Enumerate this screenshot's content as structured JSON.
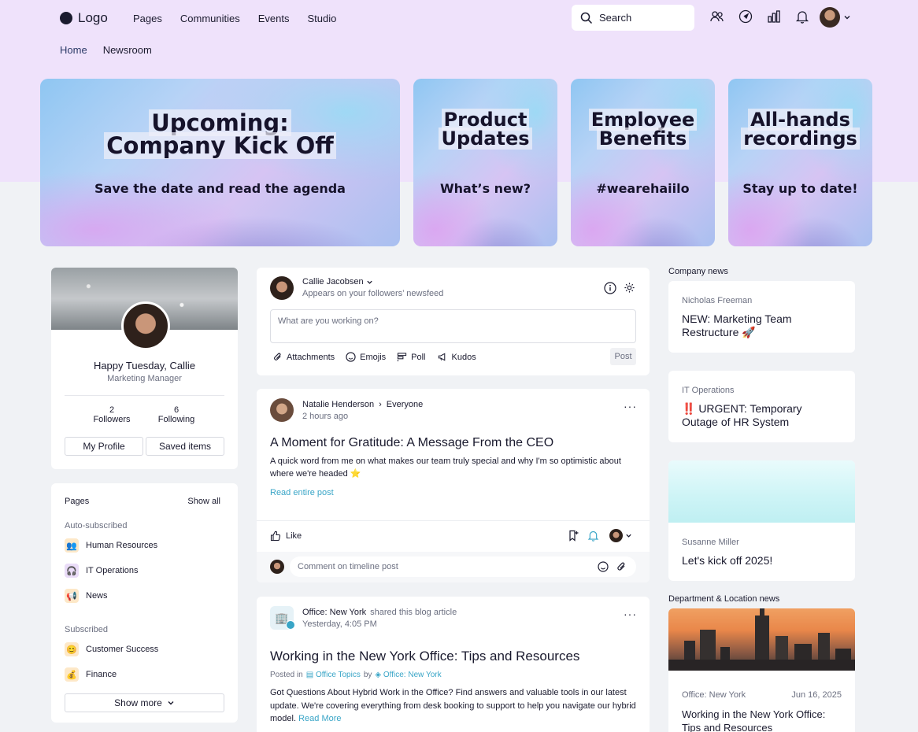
{
  "nav": {
    "logo": "Logo",
    "links": [
      "Pages",
      "Communities",
      "Events",
      "Studio"
    ],
    "search_placeholder": "Search",
    "subnav": [
      "Home",
      "Newsroom"
    ]
  },
  "banners": [
    {
      "title_line1": "Upcoming:",
      "title_line2": "Company Kick Off",
      "subtitle": "Save the date and read the agenda"
    },
    {
      "title_line1": "Product",
      "title_line2": "Updates",
      "subtitle": "What’s new?"
    },
    {
      "title_line1": "Employee",
      "title_line2": "Benefits",
      "subtitle": "#wearehaiilo"
    },
    {
      "title_line1": "All-hands",
      "title_line2": "recordings",
      "subtitle": "Stay up to date!"
    }
  ],
  "profile": {
    "greeting": "Happy Tuesday, Callie",
    "role": "Marketing Manager",
    "followers_count": "2",
    "followers_label": "Followers",
    "following_count": "6",
    "following_label": "Following",
    "my_profile": "My Profile",
    "saved_items": "Saved items"
  },
  "pages": {
    "title": "Pages",
    "show_all": "Show all",
    "auto_label": "Auto-subscribed",
    "auto_items": [
      "Human Resources",
      "IT Operations",
      "News"
    ],
    "sub_label": "Subscribed",
    "sub_items": [
      "Customer Success",
      "Finance"
    ],
    "show_more": "Show more"
  },
  "composer": {
    "author": "Callie Jacobsen",
    "audience": "Appears on your followers’ newsfeed",
    "placeholder": "What are you working on?",
    "attachments": "Attachments",
    "emojis": "Emojis",
    "poll": "Poll",
    "kudos": "Kudos",
    "post": "Post"
  },
  "post1": {
    "author": "Natalie Henderson",
    "target": "Everyone",
    "time": "2 hours ago",
    "title": "A Moment for Gratitude: A Message From the CEO",
    "body_line1": "A quick word from me on what makes our team truly special and why I'm so optimistic about",
    "body_line2": "where we're headed ⭐",
    "read_more": "Read entire post",
    "like": "Like",
    "comment_placeholder": "Comment on timeline post"
  },
  "post2": {
    "author": "Office: New York",
    "action": "shared this blog article",
    "time": "Yesterday, 4:05 PM",
    "title": "Working in the New York Office: Tips and Resources",
    "posted_in": "Posted in",
    "topic": "Office Topics",
    "by": "by",
    "by_author": "Office: New York",
    "body_line1": "Got Questions About Hybrid Work in the Office? Find answers and valuable tools in our latest",
    "body_line2": "update. We're covering everything from desk booking to support to help you navigate our hybrid",
    "body_line3": "model.",
    "read_more": "Read More"
  },
  "company_news": {
    "heading": "Company news",
    "items": [
      {
        "author": "Nicholas Freeman",
        "title_line1": "NEW: Marketing Team",
        "title_line2": "Restructure 🚀"
      },
      {
        "author": "IT Operations",
        "title_line1": "‼️ URGENT: Temporary",
        "title_line2": "Outage of HR System"
      },
      {
        "author": "Susanne Miller",
        "title_line1": "Let's kick off 2025!",
        "title_line2": ""
      }
    ]
  },
  "dept_news": {
    "heading": "Department & Location news",
    "author": "Office: New York",
    "date": "Jun 16, 2025",
    "title_line1": "Working in the New York Office:",
    "title_line2": "Tips and Resources"
  },
  "colors": {
    "header_bg": "#efe2fb",
    "page_bg": "#f0f2f5",
    "link": "#39a5c7",
    "accent_dark": "#2b3a67"
  }
}
